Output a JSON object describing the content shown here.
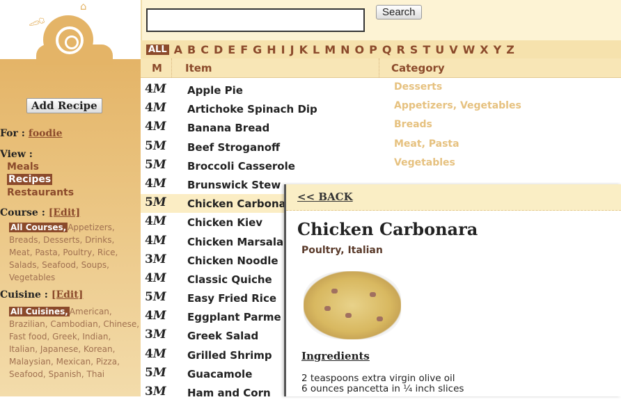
{
  "sidebar": {
    "add_recipe": "Add Recipe",
    "for_label": "For :",
    "user": "foodie",
    "view_label": "View :",
    "view_items": [
      "Meals",
      "Recipes",
      "Restaurants"
    ],
    "view_selected": "Recipes",
    "course_label": "Course :",
    "course_edit": "[Edit]",
    "course_selected": "All Courses,",
    "course_options": "Appetizers, Breads, Desserts, Drinks, Meat, Pasta, Poultry, Rice, Salads, Seafood, Soups, Vegetables",
    "cuisine_label": "Cuisine :",
    "cuisine_edit": "[Edit]",
    "cuisine_selected": "All Cuisines,",
    "cuisine_options": "American, Brazilian, Cambodian, Chinese, Fast food, Greek, Indian, Italian, Japanese, Korean, Malaysian, Mexican, Pizza, Seafood, Spanish, Thai"
  },
  "search": {
    "value": "",
    "button": "Search"
  },
  "alphabet": [
    "ALL",
    "A",
    "B",
    "C",
    "D",
    "E",
    "F",
    "G",
    "H",
    "I",
    "J",
    "K",
    "L",
    "M",
    "N",
    "O",
    "P",
    "Q",
    "R",
    "S",
    "T",
    "U",
    "V",
    "W",
    "X",
    "Y",
    "Z"
  ],
  "table": {
    "headers": {
      "m": "M",
      "item": "Item",
      "category": "Category"
    },
    "rows": [
      {
        "n": "4",
        "item": "Apple Pie",
        "category": "Desserts"
      },
      {
        "n": "4",
        "item": "Artichoke Spinach Dip",
        "category": "Appetizers, Vegetables"
      },
      {
        "n": "4",
        "item": "Banana Bread",
        "category": "Breads"
      },
      {
        "n": "5",
        "item": "Beef Stroganoff",
        "category": "Meat, Pasta"
      },
      {
        "n": "5",
        "item": "Broccoli Casserole",
        "category": "Vegetables"
      },
      {
        "n": "4",
        "item": "Brunswick Stew",
        "category": ""
      },
      {
        "n": "5",
        "item": "Chicken Carbonara",
        "category": "",
        "active": true
      },
      {
        "n": "4",
        "item": "Chicken Kiev",
        "category": ""
      },
      {
        "n": "4",
        "item": "Chicken Marsala",
        "category": ""
      },
      {
        "n": "3",
        "item": "Chicken Noodle",
        "category": ""
      },
      {
        "n": "4",
        "item": "Classic Quiche",
        "category": ""
      },
      {
        "n": "5",
        "item": "Easy Fried Rice",
        "category": ""
      },
      {
        "n": "4",
        "item": "Eggplant Parme",
        "category": ""
      },
      {
        "n": "3",
        "item": "Greek Salad",
        "category": ""
      },
      {
        "n": "4",
        "item": "Grilled Shrimp",
        "category": ""
      },
      {
        "n": "5",
        "item": "Guacamole",
        "category": ""
      },
      {
        "n": "3",
        "item": "Ham and Corn",
        "category": ""
      }
    ]
  },
  "detail": {
    "back": "<< BACK",
    "title": "Chicken Carbonara",
    "category": "Poultry, Italian",
    "ingredients_heading": "Ingredients",
    "ingredients": [
      "2 teaspoons extra virgin olive oil",
      "6 ounces pancetta in ¼ inch slices"
    ]
  },
  "colors": {
    "accent": "#8b4a2b",
    "sidebar": "#e4b467",
    "category_text": "#e6c17f",
    "header_bg": "#f8e6b6"
  }
}
